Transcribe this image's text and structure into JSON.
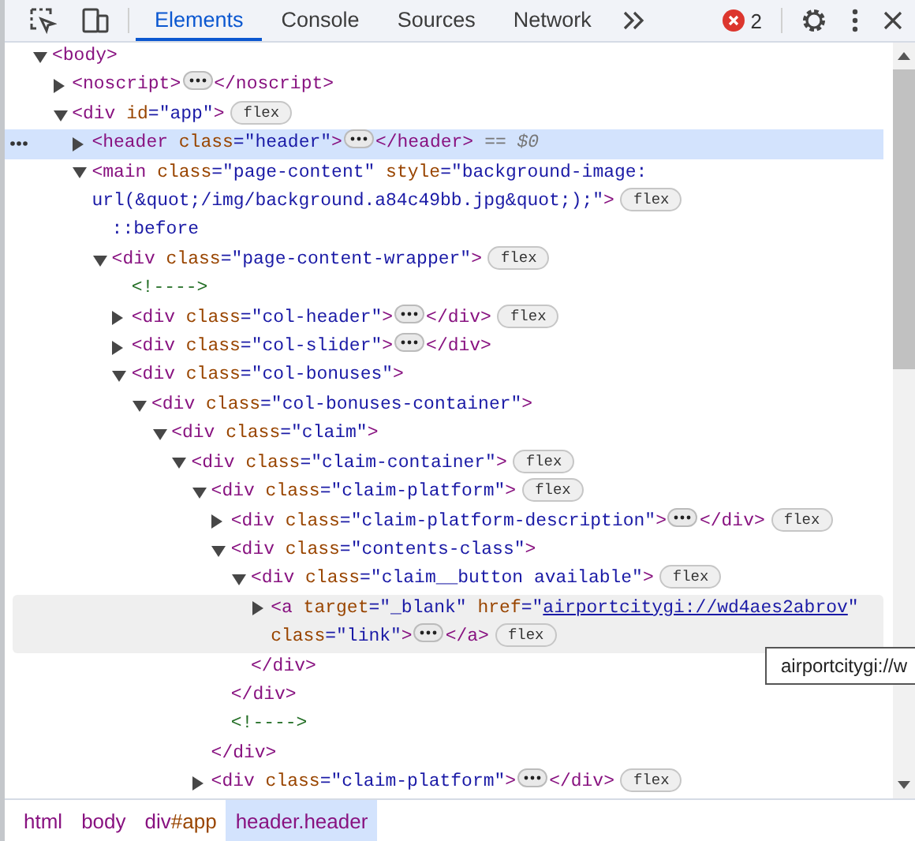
{
  "toolbar": {
    "tabs": [
      {
        "label": "Elements",
        "selected": true
      },
      {
        "label": "Console",
        "selected": false
      },
      {
        "label": "Sources",
        "selected": false
      },
      {
        "label": "Network",
        "selected": false
      }
    ],
    "error_count": "2"
  },
  "tree": [
    {
      "tokens": [
        {
          "kind": "tag",
          "text": "<body>"
        }
      ],
      "expanded": true,
      "selected": false,
      "hovered": false,
      "children": [
        {
          "tokens": [
            {
              "kind": "tag",
              "text": "<noscript>"
            }
          ],
          "expanded": false,
          "collapsed_content": true,
          "close": "</noscript>",
          "selected": false,
          "hovered": false
        },
        {
          "tokens": [
            {
              "kind": "tag",
              "text": "<div"
            },
            {
              "kind": "attr",
              "text": " id"
            },
            {
              "kind": "value",
              "text": "=\"app\""
            },
            {
              "kind": "tag",
              "text": ">"
            }
          ],
          "badge": "flex",
          "expanded": true,
          "selected": false,
          "hovered": false,
          "children": [
            {
              "tokens": [
                {
                  "kind": "tag",
                  "text": "<header"
                },
                {
                  "kind": "attr",
                  "text": " class"
                },
                {
                  "kind": "value",
                  "text": "=\"header\""
                },
                {
                  "kind": "tag",
                  "text": ">"
                }
              ],
              "expanded": false,
              "collapsed_content": true,
              "close": "</header>",
              "suffix": "== $0",
              "selected": true,
              "hovered": false
            },
            {
              "tokens": [
                {
                  "kind": "tag",
                  "text": "<main"
                },
                {
                  "kind": "attr",
                  "text": " class"
                },
                {
                  "kind": "value",
                  "text": "=\"page-content\""
                },
                {
                  "kind": "attr",
                  "text": " style"
                },
                {
                  "kind": "value",
                  "text": "=\"background-image: url(&quot;/img/background.a84c49bb.jpg&quot;);\""
                },
                {
                  "kind": "tag",
                  "text": ">"
                }
              ],
              "badge": "flex",
              "expanded": true,
              "selected": false,
              "hovered": false,
              "children": [
                {
                  "tokens": [
                    {
                      "kind": "pseudo",
                      "text": "::before"
                    }
                  ],
                  "selected": false,
                  "hovered": false
                },
                {
                  "tokens": [
                    {
                      "kind": "tag",
                      "text": "<div"
                    },
                    {
                      "kind": "attr",
                      "text": " class"
                    },
                    {
                      "kind": "value",
                      "text": "=\"page-content-wrapper\""
                    },
                    {
                      "kind": "tag",
                      "text": ">"
                    }
                  ],
                  "badge": "flex",
                  "expanded": true,
                  "selected": false,
                  "hovered": false,
                  "children": [
                    {
                      "tokens": [
                        {
                          "kind": "comment",
                          "text": "<!---->"
                        }
                      ],
                      "selected": false,
                      "hovered": false
                    },
                    {
                      "tokens": [
                        {
                          "kind": "tag",
                          "text": "<div"
                        },
                        {
                          "kind": "attr",
                          "text": " class"
                        },
                        {
                          "kind": "value",
                          "text": "=\"col-header\""
                        },
                        {
                          "kind": "tag",
                          "text": ">"
                        }
                      ],
                      "expanded": false,
                      "collapsed_content": true,
                      "close": "</div>",
                      "badge": "flex",
                      "selected": false,
                      "hovered": false
                    },
                    {
                      "tokens": [
                        {
                          "kind": "tag",
                          "text": "<div"
                        },
                        {
                          "kind": "attr",
                          "text": " class"
                        },
                        {
                          "kind": "value",
                          "text": "=\"col-slider\""
                        },
                        {
                          "kind": "tag",
                          "text": ">"
                        }
                      ],
                      "expanded": false,
                      "collapsed_content": true,
                      "close": "</div>",
                      "selected": false,
                      "hovered": false
                    },
                    {
                      "tokens": [
                        {
                          "kind": "tag",
                          "text": "<div"
                        },
                        {
                          "kind": "attr",
                          "text": " class"
                        },
                        {
                          "kind": "value",
                          "text": "=\"col-bonuses\""
                        },
                        {
                          "kind": "tag",
                          "text": ">"
                        }
                      ],
                      "expanded": true,
                      "selected": false,
                      "hovered": false,
                      "children": [
                        {
                          "tokens": [
                            {
                              "kind": "tag",
                              "text": "<div"
                            },
                            {
                              "kind": "attr",
                              "text": " class"
                            },
                            {
                              "kind": "value",
                              "text": "=\"col-bonuses-container\""
                            },
                            {
                              "kind": "tag",
                              "text": ">"
                            }
                          ],
                          "expanded": true,
                          "selected": false,
                          "hovered": false,
                          "children": [
                            {
                              "tokens": [
                                {
                                  "kind": "tag",
                                  "text": "<div"
                                },
                                {
                                  "kind": "attr",
                                  "text": " class"
                                },
                                {
                                  "kind": "value",
                                  "text": "=\"claim\""
                                },
                                {
                                  "kind": "tag",
                                  "text": ">"
                                }
                              ],
                              "expanded": true,
                              "selected": false,
                              "hovered": false,
                              "children": [
                                {
                                  "tokens": [
                                    {
                                      "kind": "tag",
                                      "text": "<div"
                                    },
                                    {
                                      "kind": "attr",
                                      "text": " class"
                                    },
                                    {
                                      "kind": "value",
                                      "text": "=\"claim-container\""
                                    },
                                    {
                                      "kind": "tag",
                                      "text": ">"
                                    }
                                  ],
                                  "badge": "flex",
                                  "expanded": true,
                                  "selected": false,
                                  "hovered": false,
                                  "children": [
                                    {
                                      "tokens": [
                                        {
                                          "kind": "tag",
                                          "text": "<div"
                                        },
                                        {
                                          "kind": "attr",
                                          "text": " class"
                                        },
                                        {
                                          "kind": "value",
                                          "text": "=\"claim-platform\""
                                        },
                                        {
                                          "kind": "tag",
                                          "text": ">"
                                        }
                                      ],
                                      "badge": "flex",
                                      "expanded": true,
                                      "end": "</div>",
                                      "selected": false,
                                      "hovered": false,
                                      "children": [
                                        {
                                          "tokens": [
                                            {
                                              "kind": "tag",
                                              "text": "<div"
                                            },
                                            {
                                              "kind": "attr",
                                              "text": " class"
                                            },
                                            {
                                              "kind": "value",
                                              "text": "=\"claim-platform-description\""
                                            },
                                            {
                                              "kind": "tag",
                                              "text": ">"
                                            }
                                          ],
                                          "expanded": false,
                                          "collapsed_content": true,
                                          "close": "</div>",
                                          "badge": "flex",
                                          "selected": false,
                                          "hovered": false
                                        },
                                        {
                                          "tokens": [
                                            {
                                              "kind": "tag",
                                              "text": "<div"
                                            },
                                            {
                                              "kind": "attr",
                                              "text": " class"
                                            },
                                            {
                                              "kind": "value",
                                              "text": "=\"contents-class\""
                                            },
                                            {
                                              "kind": "tag",
                                              "text": ">"
                                            }
                                          ],
                                          "expanded": true,
                                          "end": "</div>",
                                          "selected": false,
                                          "hovered": false,
                                          "children": [
                                            {
                                              "tokens": [
                                                {
                                                  "kind": "tag",
                                                  "text": "<div"
                                                },
                                                {
                                                  "kind": "attr",
                                                  "text": " class"
                                                },
                                                {
                                                  "kind": "value",
                                                  "text": "=\"claim__button available\""
                                                },
                                                {
                                                  "kind": "tag",
                                                  "text": ">"
                                                }
                                              ],
                                              "badge": "flex",
                                              "expanded": true,
                                              "end": "</div>",
                                              "selected": false,
                                              "hovered": false,
                                              "children": [
                                                {
                                                  "tokens": [
                                                    {
                                                      "kind": "tag",
                                                      "text": "<a"
                                                    },
                                                    {
                                                      "kind": "attr",
                                                      "text": " target"
                                                    },
                                                    {
                                                      "kind": "value",
                                                      "text": "=\"_blank\""
                                                    },
                                                    {
                                                      "kind": "attr",
                                                      "text": " href"
                                                    },
                                                    {
                                                      "kind": "value",
                                                      "text": "=\""
                                                    },
                                                    {
                                                      "kind": "link",
                                                      "text": "airportcitygi://wd4aes2abrov"
                                                    },
                                                    {
                                                      "kind": "value",
                                                      "text": "\""
                                                    },
                                                    {
                                                      "kind": "attr",
                                                      "text": " class"
                                                    },
                                                    {
                                                      "kind": "value",
                                                      "text": "=\"link\""
                                                    },
                                                    {
                                                      "kind": "tag",
                                                      "text": ">"
                                                    }
                                                  ],
                                                  "expanded": false,
                                                  "collapsed_content": true,
                                                  "close": "</a>",
                                                  "badge": "flex",
                                                  "selected": false,
                                                  "hovered": true
                                                }
                                              ]
                                            }
                                          ]
                                        },
                                        {
                                          "tokens": [
                                            {
                                              "kind": "comment",
                                              "text": "<!---->"
                                            }
                                          ],
                                          "selected": false,
                                          "hovered": false
                                        }
                                      ]
                                    },
                                    {
                                      "tokens": [
                                        {
                                          "kind": "tag",
                                          "text": "<div"
                                        },
                                        {
                                          "kind": "attr",
                                          "text": " class"
                                        },
                                        {
                                          "kind": "value",
                                          "text": "=\"claim-platform\""
                                        },
                                        {
                                          "kind": "tag",
                                          "text": ">"
                                        }
                                      ],
                                      "expanded": false,
                                      "collapsed_content": true,
                                      "close": "</div>",
                                      "badge": "flex",
                                      "selected": false,
                                      "hovered": false
                                    }
                                  ]
                                }
                              ]
                            }
                          ]
                        }
                      ]
                    }
                  ]
                }
              ]
            }
          ]
        }
      ]
    }
  ],
  "tooltip": "airportcitygi://w",
  "breadcrumbs": [
    {
      "tag": "html",
      "selected": false
    },
    {
      "tag": "body",
      "selected": false
    },
    {
      "tag": "div",
      "suffix": "#app",
      "selected": false
    },
    {
      "tag": "header",
      "suffix": ".header",
      "selected": true
    }
  ]
}
